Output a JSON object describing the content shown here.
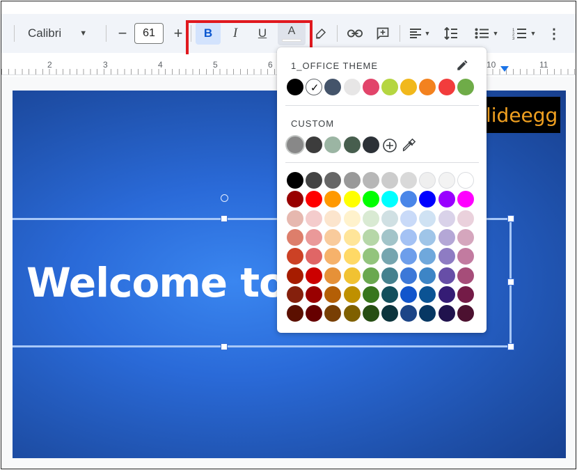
{
  "toolbar": {
    "font_name": "Calibri",
    "font_size": "61",
    "decrease_label": "−",
    "increase_label": "+",
    "bold_label": "B",
    "italic_label": "I",
    "underline_label": "U",
    "text_color_label": "A",
    "icons": [
      "highlighter-icon",
      "link-icon",
      "comment-icon",
      "align-icon",
      "line-spacing-icon",
      "bullet-list-icon",
      "numbered-list-icon",
      "more-icon"
    ],
    "colors": {
      "active_button_bg": "#d3e3fd",
      "highlight_box": "#e0191f"
    }
  },
  "ruler": {
    "numbers": [
      "2",
      "3",
      "4",
      "5",
      "6",
      "10",
      "11"
    ]
  },
  "slide": {
    "title": "Welcome to S",
    "logo_text": "lideegg",
    "background": "#2a6ad8"
  },
  "color_picker": {
    "theme_title": "1_OFFICE THEME",
    "custom_title": "CUSTOM",
    "theme_colors": [
      "#000000",
      "#ffffff",
      "#44546a",
      "#e7e6e6",
      "#e2446a",
      "#b5d641",
      "#f1b81c",
      "#f3821f",
      "#f23c3c",
      "#6fac48"
    ],
    "custom_colors": [
      "#888888",
      "#3c3c3c",
      "#9bb5a3",
      "#475e4e",
      "#2c3137"
    ],
    "grid": [
      [
        "#000000",
        "#434343",
        "#666666",
        "#999999",
        "#b7b7b7",
        "#cccccc",
        "#d9d9d9",
        "#efefef",
        "#f3f3f3",
        "#ffffff"
      ],
      [
        "#980000",
        "#ff0000",
        "#ff9900",
        "#ffff00",
        "#00ff00",
        "#00ffff",
        "#4a86e8",
        "#0000ff",
        "#9900ff",
        "#ff00ff"
      ],
      [
        "#e6b8af",
        "#f4cccc",
        "#fce5cd",
        "#fff2cc",
        "#d9ead3",
        "#d0e0e3",
        "#c9daf8",
        "#cfe2f3",
        "#d9d2e9",
        "#ead1dc"
      ],
      [
        "#dd7e6b",
        "#ea9999",
        "#f9cb9c",
        "#ffe599",
        "#b6d7a8",
        "#a2c4c9",
        "#a4c2f4",
        "#9fc5e8",
        "#b4a7d6",
        "#d5a6bd"
      ],
      [
        "#cc4125",
        "#e06666",
        "#f6b26b",
        "#ffd966",
        "#93c47d",
        "#76a5af",
        "#6d9eeb",
        "#6fa8dc",
        "#8e7cc3",
        "#c27ba0"
      ],
      [
        "#a61c00",
        "#cc0000",
        "#e69138",
        "#f1c232",
        "#6aa84f",
        "#45818e",
        "#3c78d8",
        "#3d85c6",
        "#674ea7",
        "#a64d79"
      ],
      [
        "#85200c",
        "#990000",
        "#b45f06",
        "#bf9000",
        "#38761d",
        "#134f5c",
        "#1155cc",
        "#0b5394",
        "#351c75",
        "#741b47"
      ],
      [
        "#5b0f00",
        "#660000",
        "#783f04",
        "#7f6000",
        "#274e13",
        "#0c343d",
        "#1c4587",
        "#073763",
        "#20124d",
        "#4c1130"
      ]
    ],
    "selected_theme_index": 1
  }
}
